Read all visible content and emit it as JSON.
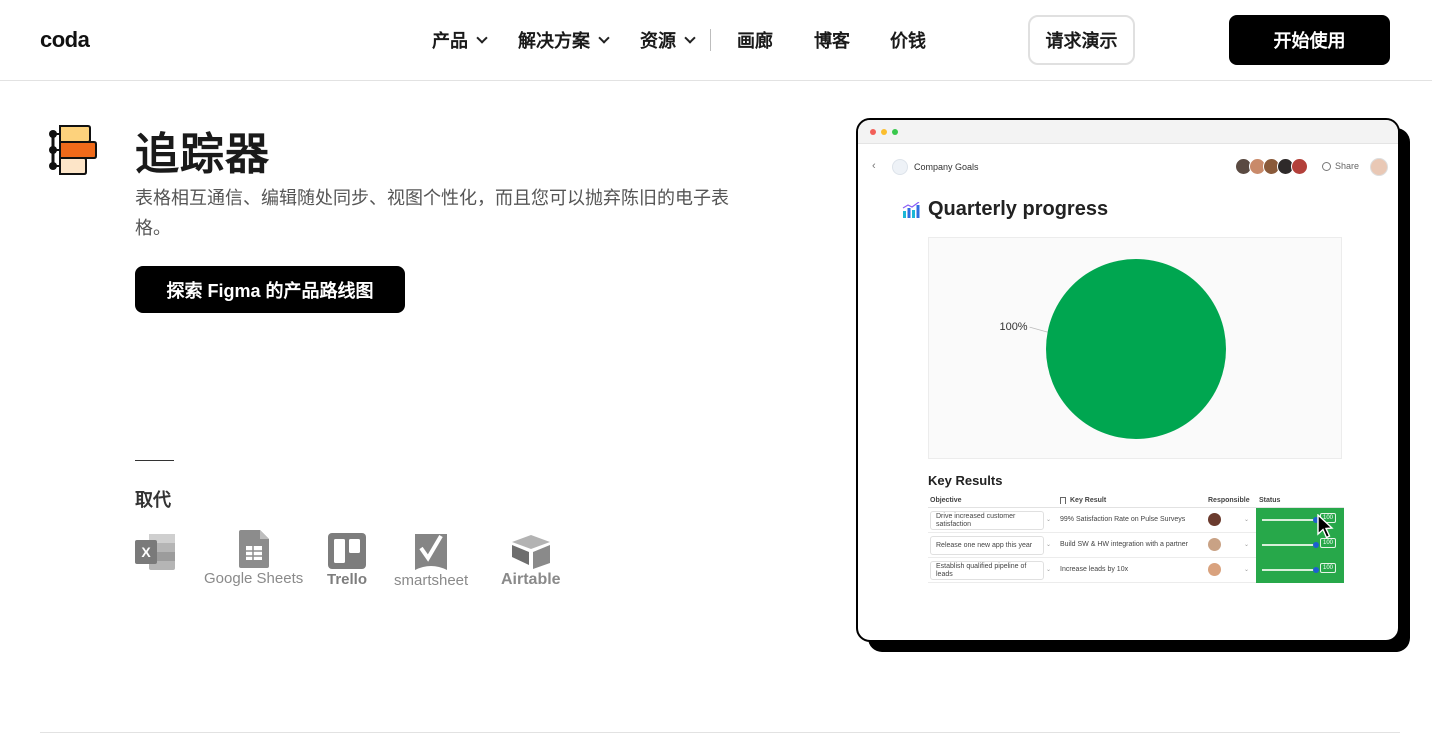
{
  "header": {
    "logo": "coda",
    "nav": [
      {
        "label": "产品",
        "dropdown": true
      },
      {
        "label": "解决方案",
        "dropdown": true
      },
      {
        "label": "资源",
        "dropdown": true
      },
      {
        "label": "画廊",
        "dropdown": false
      },
      {
        "label": "博客",
        "dropdown": false
      },
      {
        "label": "价钱",
        "dropdown": false
      }
    ],
    "demo_label": "请求演示",
    "start_label": "开始使用"
  },
  "hero": {
    "icon": "tracker-icon",
    "title": "追踪器",
    "subtitle": "表格相互通信、编辑随处同步、视图个性化，而且您可以抛弃陈旧的电子表格。",
    "cta_label": "探索 Figma 的产品路线图"
  },
  "replaces": {
    "label": "取代",
    "brands": [
      {
        "name": "",
        "icon": "excel-icon"
      },
      {
        "name": "Google Sheets",
        "icon": "google-sheets-icon"
      },
      {
        "name": "Trello",
        "icon": "trello-icon"
      },
      {
        "name": "smartsheet",
        "icon": "smartsheet-icon"
      },
      {
        "name": "Airtable",
        "icon": "airtable-icon"
      }
    ]
  },
  "mockup": {
    "doc_name": "Company Goals",
    "share_label": "Share",
    "title": "Quarterly progress",
    "key_results_title": "Key Results",
    "table": {
      "columns": [
        "Objective",
        "Key Result",
        "Responsible",
        "Status"
      ],
      "rows": [
        {
          "objective": "Drive increased customer satisfaction",
          "key_result": "99% Satisfaction Rate on Pulse Surveys",
          "status": 100
        },
        {
          "objective": "Release one new app this year",
          "key_result": "Build SW & HW integration with a partner",
          "status": 100
        },
        {
          "objective": "Establish qualified pipeline of leads",
          "key_result": "Increase leads by 10x",
          "status": 100
        }
      ]
    }
  },
  "chart_data": {
    "type": "pie",
    "categories": [
      ""
    ],
    "values": [
      100
    ],
    "data_labels": [
      "100%"
    ],
    "colors": [
      "#00a650"
    ],
    "title": "",
    "legend": "none"
  },
  "colors": {
    "brand_black": "#000000",
    "accent_green": "#00a650",
    "status_green": "#27a84a",
    "tracker_orange": "#f06a1a",
    "tracker_yellow": "#fdd27c",
    "tracker_peach": "#fde5c8"
  }
}
